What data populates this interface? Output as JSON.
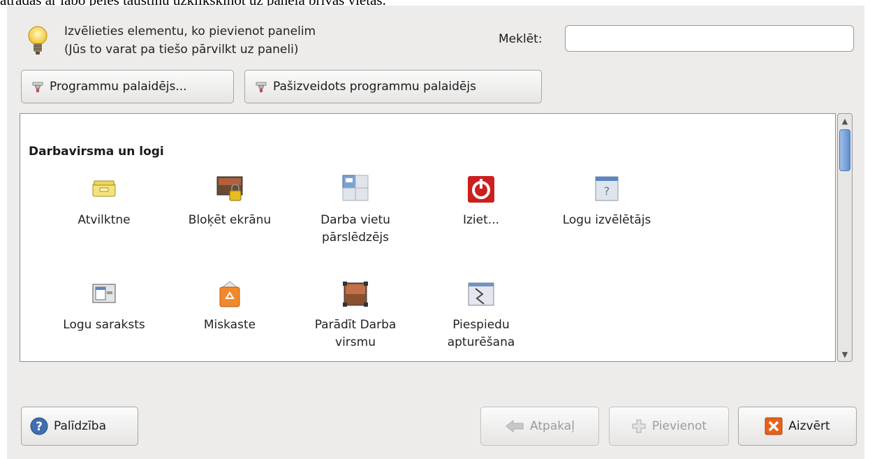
{
  "top_caption": "atradās ar labo peles taustiņu uzklikšķinot uz paneļa brīvās vietas.",
  "instructions": {
    "line1": "Izvēlieties elementu, ko pievienot panelim",
    "line2": "(Jūs to varat pa tiešo pārvilkt uz paneli)"
  },
  "search": {
    "label": "Meklēt:",
    "value": ""
  },
  "launchers": {
    "program_launcher": "Programmu palaidējs...",
    "custom_launcher": "Pašizveidots programmu palaidējs"
  },
  "section_title": "Darbavirsma un logi",
  "items": [
    {
      "label": "Atvilktne",
      "icon": "drawer-icon"
    },
    {
      "label": "Bloķēt ekrānu",
      "icon": "lock-screen-icon"
    },
    {
      "label": "Darba vietu pārslēdzējs",
      "icon": "workspace-switcher-icon"
    },
    {
      "label": "Iziet...",
      "icon": "logout-icon"
    },
    {
      "label": "Logu izvēlētājs",
      "icon": "window-selector-icon"
    },
    {
      "label": "Logu saraksts",
      "icon": "window-list-icon"
    },
    {
      "label": "Miskaste",
      "icon": "trash-icon"
    },
    {
      "label": "Parādīt Darba virsmu",
      "icon": "show-desktop-icon"
    },
    {
      "label": "Piespiedu apturēšana",
      "icon": "force-quit-icon"
    }
  ],
  "buttons": {
    "help": "Palīdzība",
    "back": "Atpakaļ",
    "add": "Pievienot",
    "close": "Aizvērt"
  },
  "colors": {
    "accent": "#3f6fb0",
    "close_icon": "#e8621a",
    "logout": "#cc1f1f"
  }
}
